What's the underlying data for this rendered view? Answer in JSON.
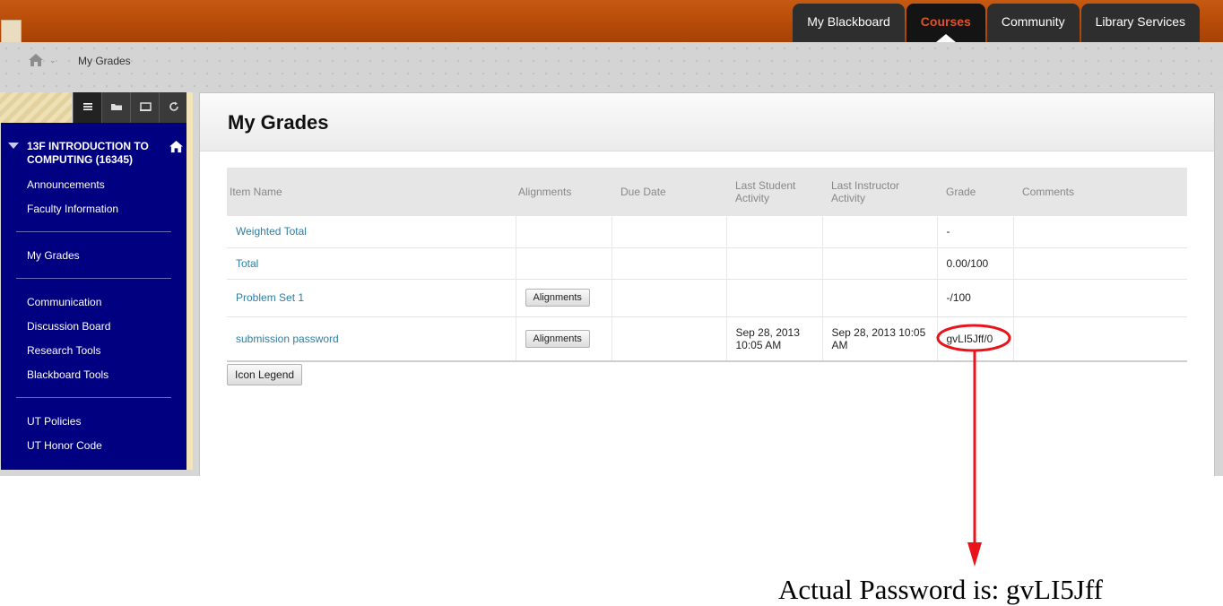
{
  "topnav": {
    "tabs": [
      {
        "label": "My Blackboard"
      },
      {
        "label": "Courses"
      },
      {
        "label": "Community"
      },
      {
        "label": "Library Services"
      }
    ]
  },
  "breadcrumb": {
    "current": "My Grades"
  },
  "course": {
    "title": "13F INTRODUCTION TO COMPUTING (16345)"
  },
  "menu": {
    "items": [
      {
        "label": "Announcements"
      },
      {
        "label": "Faculty Information"
      },
      {
        "label": "My Grades"
      },
      {
        "label": "Communication"
      },
      {
        "label": "Discussion Board"
      },
      {
        "label": "Research Tools"
      },
      {
        "label": "Blackboard Tools"
      },
      {
        "label": "UT Policies"
      },
      {
        "label": "UT Honor Code"
      }
    ]
  },
  "page": {
    "title": "My Grades"
  },
  "table": {
    "headers": [
      "Item Name",
      "Alignments",
      "Due Date",
      "Last Student Activity",
      "Last Instructor Activity",
      "Grade",
      "Comments"
    ],
    "rows": [
      {
        "name": "Weighted Total",
        "alignments": "",
        "due": "",
        "student": "",
        "instructor": "",
        "grade": "-",
        "comments": ""
      },
      {
        "name": "Total",
        "alignments": "",
        "due": "",
        "student": "",
        "instructor": "",
        "grade": "0.00/100",
        "comments": ""
      },
      {
        "name": "Problem Set 1",
        "alignments": "Alignments",
        "due": "",
        "student": "",
        "instructor": "",
        "grade": "-/100",
        "comments": ""
      },
      {
        "name": "submission password",
        "alignments": "Alignments",
        "due": "",
        "student": "Sep 28, 2013 10:05 AM",
        "instructor": "Sep 28, 2013 10:05 AM",
        "grade": "gvLI5Jff/0",
        "comments": ""
      }
    ]
  },
  "icon_legend_label": "Icon Legend",
  "annotation": {
    "text": "Actual Password is: gvLI5Jff",
    "color": "#e8141c"
  }
}
